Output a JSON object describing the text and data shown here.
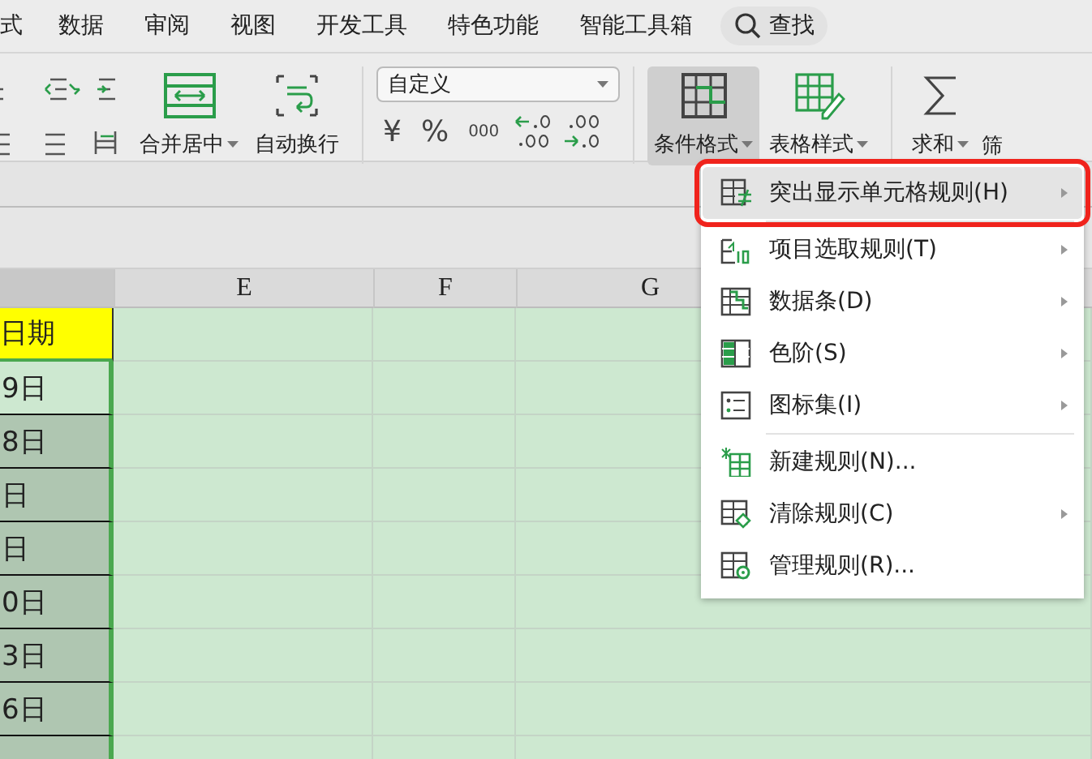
{
  "menu_tabs": [
    {
      "label": "式",
      "selected": false
    },
    {
      "label": "数据",
      "selected": false
    },
    {
      "label": "审阅",
      "selected": false
    },
    {
      "label": "视图",
      "selected": false
    },
    {
      "label": "开发工具",
      "selected": false
    },
    {
      "label": "特色功能",
      "selected": false
    },
    {
      "label": "智能工具箱",
      "selected": false
    }
  ],
  "search": {
    "label": "查找"
  },
  "ribbon": {
    "merge_button": "合并居中",
    "wrap_button": "自动换行",
    "number_format": "自定义",
    "currency_symbol": "¥",
    "percent_symbol": "%",
    "thousands_symbol": "000",
    "conditional_format": {
      "label": "条件格式",
      "selected": true
    },
    "table_style": "表格样式",
    "sum": "求和",
    "cut_button": "筛"
  },
  "sheet": {
    "columns": [
      "E",
      "F",
      "G"
    ],
    "header_cell": "日期",
    "rows": [
      "9日",
      "8日",
      "日",
      "日",
      "0日",
      "3日",
      "6日"
    ]
  },
  "context_menu": [
    {
      "label": "突出显示单元格规则(H)",
      "kind": "neq",
      "submenu": true,
      "selected": true,
      "annotated": true
    },
    {
      "label": "项目选取规则(T)",
      "kind": "top",
      "submenu": true,
      "selected": false,
      "annotated": false
    },
    {
      "label": "数据条(D)",
      "kind": "bars",
      "submenu": true,
      "selected": false,
      "annotated": false
    },
    {
      "label": "色阶(S)",
      "kind": "scale",
      "submenu": true,
      "selected": false,
      "annotated": false
    },
    {
      "label": "图标集(I)",
      "kind": "icons",
      "submenu": true,
      "selected": false,
      "annotated": false
    },
    {
      "label": "新建规则(N)...",
      "kind": "new",
      "submenu": false,
      "selected": false,
      "annotated": false
    },
    {
      "label": "清除规则(C)",
      "kind": "clear",
      "submenu": true,
      "selected": false,
      "annotated": false
    },
    {
      "label": "管理规则(R)...",
      "kind": "manage",
      "submenu": false,
      "selected": false,
      "annotated": false
    }
  ]
}
